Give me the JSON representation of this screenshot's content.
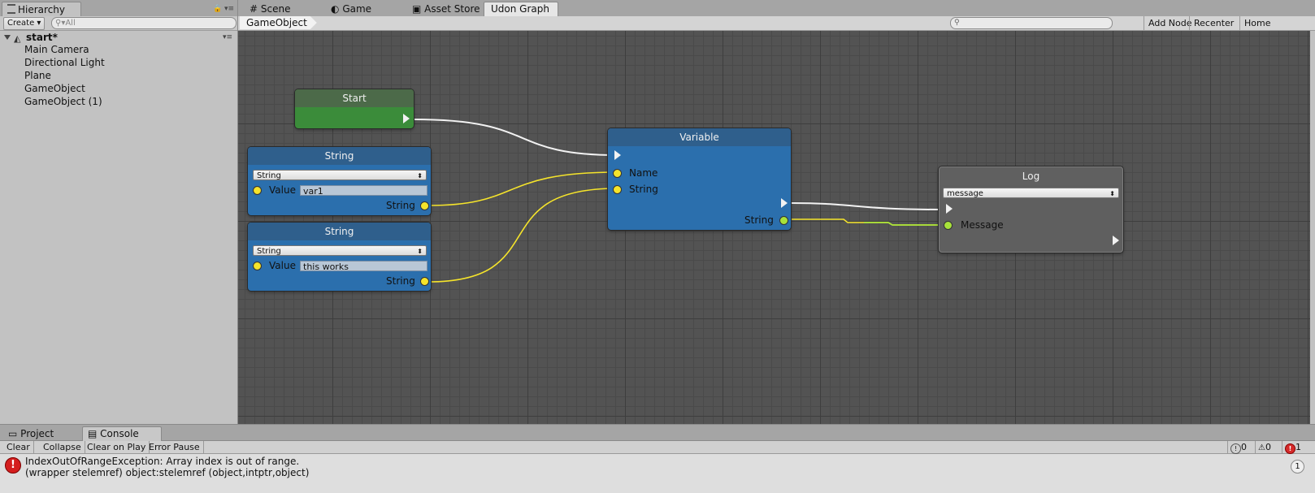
{
  "hierarchy": {
    "tab_label": "Hierarchy",
    "create_label": "Create",
    "search_placeholder": "All",
    "scene_name": "start*",
    "items": [
      "Main Camera",
      "Directional Light",
      "Plane",
      "GameObject",
      "GameObject (1)"
    ]
  },
  "tabs": [
    "Scene",
    "Game",
    "Asset Store",
    "Udon Graph"
  ],
  "graph_toolbar": {
    "breadcrumb": "GameObject",
    "buttons": [
      "Add Node",
      "Recenter",
      "Home"
    ]
  },
  "nodes": {
    "start": {
      "title": "Start"
    },
    "string1": {
      "title": "String",
      "type_option": "String",
      "value_label": "Value",
      "value": "var1",
      "output_label": "String"
    },
    "string2": {
      "title": "String",
      "type_option": "String",
      "value_label": "Value",
      "value": "this works",
      "output_label": "String"
    },
    "variable": {
      "title": "Variable",
      "input_name": "Name",
      "input_string": "String",
      "output_label": "String"
    },
    "log": {
      "title": "Log",
      "option": "message",
      "input_label": "Message"
    }
  },
  "colors": {
    "graph_bg": "#535353",
    "node_blue": "#2b6fad",
    "node_green": "#3b8c3a",
    "wire_flow": "#f2f2f2",
    "wire_string": "#f5e42b",
    "wire_object": "#a8e23a",
    "error_red": "#d41e1e"
  },
  "bottom_tabs": [
    "Project",
    "Console"
  ],
  "console": {
    "buttons": [
      "Clear",
      "Collapse",
      "Clear on Play",
      "Error Pause"
    ],
    "counts": {
      "info": "0",
      "warnings": "0",
      "errors": "1"
    },
    "log": {
      "line1": "IndexOutOfRangeException: Array index is out of range.",
      "line2": "(wrapper stelemref) object:stelemref (object,intptr,object)",
      "count": "1"
    }
  }
}
